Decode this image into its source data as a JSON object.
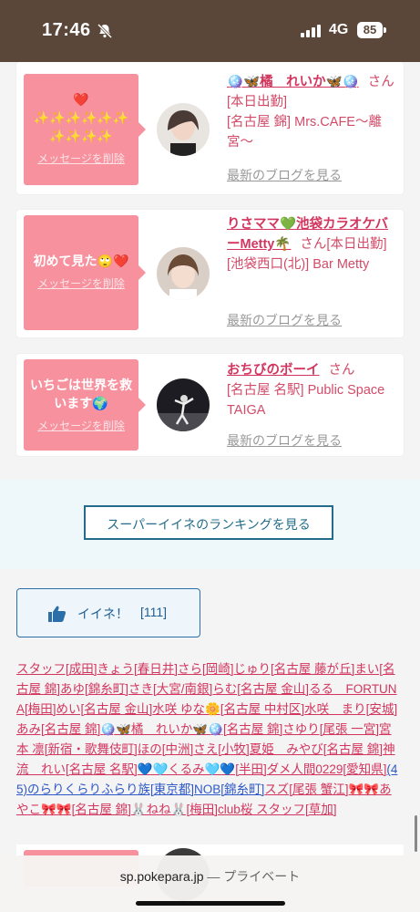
{
  "status": {
    "time": "17:46",
    "network": "4G",
    "battery": "85"
  },
  "cards": [
    {
      "message_lines": [
        "❤️",
        "✨✨✨✨✨✨",
        "✨✨✨✨"
      ],
      "delete": "メッセージを削除",
      "name": "🪩🦋橘　れいか🦋🪩",
      "san": "さん",
      "details": [
        "[本日出勤]",
        "[名古屋 錦] Mrs.CAFE〜離宮〜"
      ],
      "blog": "最新のブログを見る"
    },
    {
      "message_lines": [
        "初めて見た🙄❤️"
      ],
      "delete": "メッセージを削除",
      "name": "りさママ💚池袋カラオケバーMetty🌴",
      "san": "さん",
      "details": [
        "[本日出勤]",
        "[池袋西口(北)] Bar Metty"
      ],
      "blog": "最新のブログを見る"
    },
    {
      "message_lines": [
        "いちごは世界を救",
        "います🌍"
      ],
      "delete": "メッセージを削除",
      "name": "おちびのボーイ",
      "san": "さん",
      "details": [
        "[名古屋 名駅] Public Space TAIGA"
      ],
      "blog": "最新のブログを見る"
    }
  ],
  "ranking_button": "スーパーイイネのランキングを見る",
  "like": {
    "label": "イイネ！",
    "count": "[111]"
  },
  "likers": [
    {
      "t": "スタッフ[成田]"
    },
    {
      "t": "きょう[春日井]"
    },
    {
      "t": "さら[岡崎]"
    },
    {
      "t": "じゅり[名古屋 藤が丘]"
    },
    {
      "t": "まい[名古屋 錦]"
    },
    {
      "t": "あゆ[錦糸町]"
    },
    {
      "t": "さき[大宮/南銀]"
    },
    {
      "t": "らむ[名古屋 金山]"
    },
    {
      "t": "るる　FORTUNA[梅田]"
    },
    {
      "t": "めい[名古屋 金山]"
    },
    {
      "t": "水咲 ゆな🌼[名古屋 中村区]"
    },
    {
      "t": "水咲　まり[安城]"
    },
    {
      "t": "あみ[名古屋 錦]"
    },
    {
      "t": "🪩🦋橘　れいか🦋🪩[名古屋 錦]"
    },
    {
      "t": "さゆり[尾張 一宮]"
    },
    {
      "t": "宮本 凛[新宿・歌舞伎町]"
    },
    {
      "t": "ほの[中洲]"
    },
    {
      "t": "さえ[小牧]"
    },
    {
      "t": "夏姫　みやび[名古屋 錦]"
    },
    {
      "t": "神流　れい[名古屋 名駅]"
    },
    {
      "t": "💙🩵くるみ🩵💙[半田]"
    },
    {
      "t": "ダメ人間0229[愛知県]"
    },
    {
      "t": "(45)のらりくらりふらり族[東京都]",
      "blue": true
    },
    {
      "t": "NOB[錦糸町]",
      "blue": true
    },
    {
      "t": "スズ[尾張 蟹江]"
    },
    {
      "t": "🎀🎀あやこ🎀🎀[名古屋 錦]"
    },
    {
      "t": "🐰ねね🐰[梅田]"
    },
    {
      "t": "club桜 スタッフ[草加]"
    }
  ],
  "url": {
    "domain": "sp.pokepara.jp",
    "sep": " — ",
    "mode": "プライベート"
  }
}
